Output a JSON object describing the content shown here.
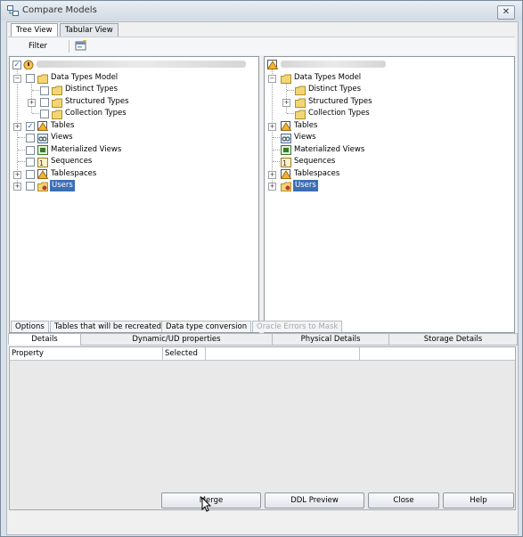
{
  "window": {
    "title": "Compare Models"
  },
  "view_tabs": [
    "Tree View",
    "Tabular View"
  ],
  "toolbar": {
    "filter_label": "Filter"
  },
  "left_tree": {
    "root_checked": true,
    "items": [
      {
        "label": "Data Types Model",
        "checked": false
      },
      {
        "label": "Distinct Types",
        "checked": false
      },
      {
        "label": "Structured Types",
        "checked": false
      },
      {
        "label": "Collection Types",
        "checked": false
      },
      {
        "label": "Tables",
        "checked": true
      },
      {
        "label": "Views",
        "checked": false
      },
      {
        "label": "Materialized Views",
        "checked": false
      },
      {
        "label": "Sequences",
        "checked": false
      },
      {
        "label": "Tablespaces",
        "checked": false
      },
      {
        "label": "Users",
        "checked": false,
        "selected": true
      }
    ]
  },
  "right_tree": {
    "items": [
      {
        "label": "Data Types Model"
      },
      {
        "label": "Distinct Types"
      },
      {
        "label": "Structured Types"
      },
      {
        "label": "Collection Types"
      },
      {
        "label": "Tables"
      },
      {
        "label": "Views"
      },
      {
        "label": "Materialized Views"
      },
      {
        "label": "Sequences"
      },
      {
        "label": "Tablespaces"
      },
      {
        "label": "Users",
        "selected": true
      }
    ]
  },
  "option_tabs": [
    "Options",
    "Tables that will be recreated",
    "Data type conversion",
    "Oracle Errors to Mask"
  ],
  "detail_tabs": [
    "Details",
    "Dynamic/UD properties",
    "Physical Details",
    "Storage Details"
  ],
  "grid": {
    "columns": [
      "Property",
      "Selected",
      "",
      ""
    ]
  },
  "buttons": {
    "merge": "Merge",
    "ddl_preview": "DDL Preview",
    "close": "Close",
    "help": "Help"
  },
  "colors": {
    "selection": "#3c6eb4",
    "folder": "#f2d675",
    "warning": "#e8a72a"
  }
}
